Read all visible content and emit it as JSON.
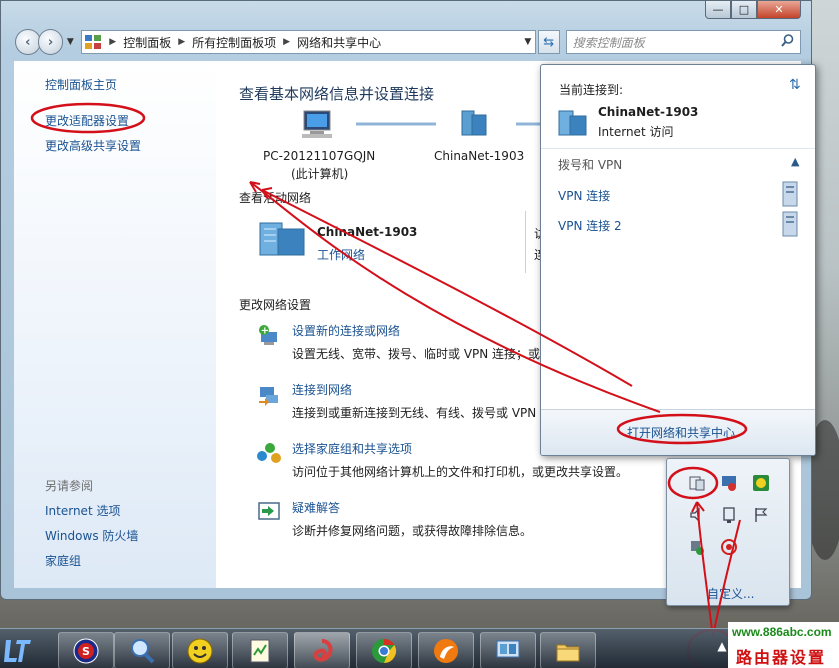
{
  "window": {
    "caption": {
      "minimize": "—",
      "maximize": "□",
      "close": "✕"
    }
  },
  "address_bar": {
    "breadcrumbs": [
      "控制面板",
      "所有控制面板项",
      "网络和共享中心"
    ],
    "search_placeholder": "搜索控制面板"
  },
  "sidebar": {
    "home": "控制面板主页",
    "items": [
      "更改适配器设置",
      "更改高级共享设置"
    ],
    "see_also_title": "另请参阅",
    "see_also": [
      "Internet 选项",
      "Windows 防火墙",
      "家庭组"
    ]
  },
  "main": {
    "heading": "查看基本网络信息并设置连接",
    "network_map": {
      "computer": "PC-20121107GQJN",
      "computer_sub": "(此计算机)",
      "network": "ChinaNet-1903"
    },
    "active_title": "查看活动网络",
    "active": {
      "name": "ChinaNet-1903",
      "type": "工作网络",
      "col2_1": "访",
      "col2_2": "连"
    },
    "change_title": "更改网络设置",
    "tasks": [
      {
        "link": "设置新的连接或网络",
        "desc": "设置无线、宽带、拨号、临时或 VPN 连接；或"
      },
      {
        "link": "连接到网络",
        "desc": "连接到或重新连接到无线、有线、拨号或 VPN"
      },
      {
        "link": "选择家庭组和共享选项",
        "desc": "访问位于其他网络计算机上的文件和打印机，或更改共享设置。"
      },
      {
        "link": "疑难解答",
        "desc": "诊断并修复网络问题，或获得故障排除信息。"
      }
    ]
  },
  "flyout": {
    "current_label": "当前连接到:",
    "network_name": "ChinaNet-1903",
    "network_access": "Internet 访问",
    "section": "拨号和 VPN",
    "vpns": [
      "VPN 连接",
      "VPN 连接 2"
    ],
    "footer_link": "打开网络和共享中心"
  },
  "tray": {
    "customize": "自定义..."
  },
  "watermark": {
    "url": "www.886abc.com",
    "text": "路由器设置"
  },
  "colors": {
    "link": "#1a5291",
    "annotation": "#d3101a",
    "heading": "#1e395b"
  }
}
